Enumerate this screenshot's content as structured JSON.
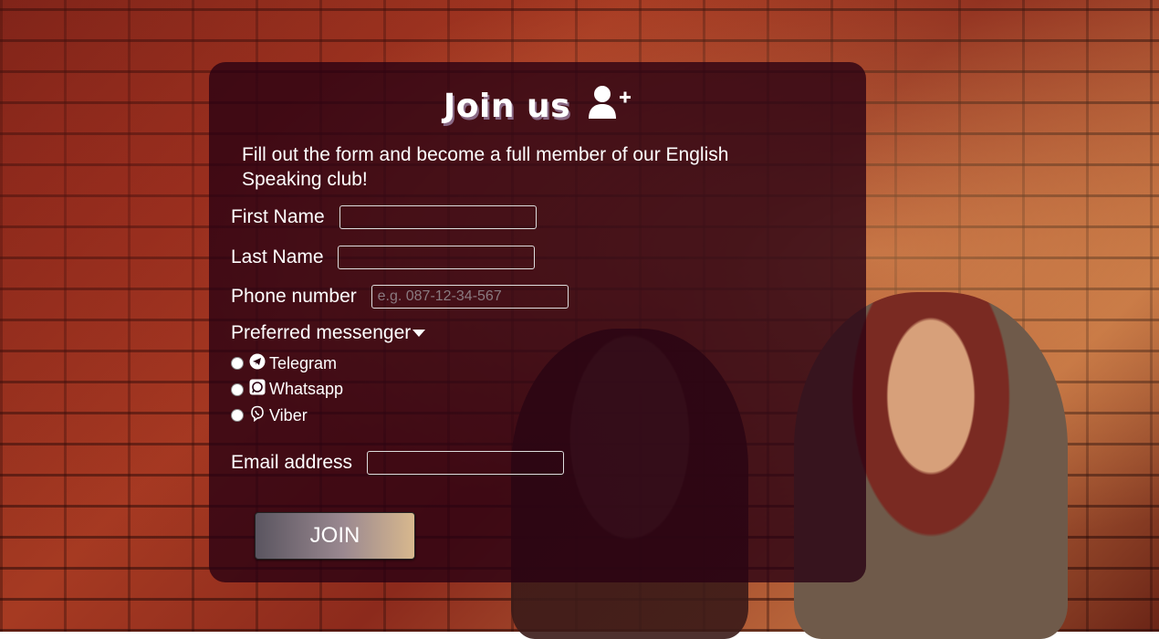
{
  "form": {
    "title": "Join us",
    "title_icon": "add-user-icon",
    "intro": "Fill out the form and become a full member of our English Speaking club!",
    "fields": {
      "first_name": {
        "label": "First Name",
        "value": "",
        "placeholder": ""
      },
      "last_name": {
        "label": "Last Name",
        "value": "",
        "placeholder": ""
      },
      "phone": {
        "label": "Phone number",
        "value": "",
        "placeholder": "e.g. 087-12-34-567"
      },
      "email": {
        "label": "Email address",
        "value": "",
        "placeholder": ""
      }
    },
    "messenger": {
      "label": "Preferred messenger",
      "options": [
        {
          "label": "Telegram",
          "icon": "telegram-icon"
        },
        {
          "label": "Whatsapp",
          "icon": "whatsapp-icon"
        },
        {
          "label": "Viber",
          "icon": "viber-icon"
        }
      ]
    },
    "submit_label": "JOIN"
  },
  "colors": {
    "card_bg": "#28001282",
    "button_start": "#5a5560",
    "button_end": "#d8b88e"
  }
}
